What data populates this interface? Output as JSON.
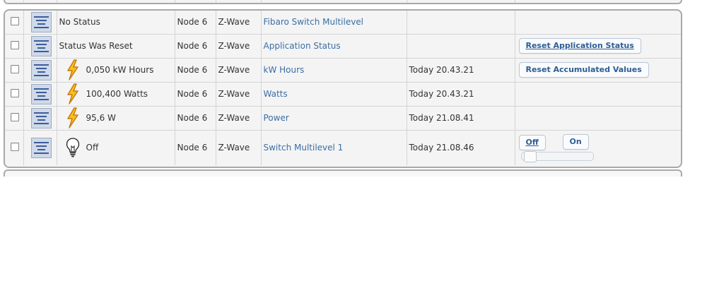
{
  "rows": [
    {
      "value": "No Status",
      "node": "Node 6",
      "type": "Z-Wave",
      "name": "Fibaro Switch Multilevel",
      "time": "",
      "icon": "none"
    },
    {
      "value": "Status Was Reset",
      "node": "Node 6",
      "type": "Z-Wave",
      "name": "Application Status",
      "time": "",
      "icon": "none",
      "action": "Reset Application Status"
    },
    {
      "value": "0,050 kW Hours",
      "node": "Node 6",
      "type": "Z-Wave",
      "name": "kW Hours",
      "time": "Today 20.43.21",
      "icon": "lightning-icon",
      "action": "Reset Accumulated Values"
    },
    {
      "value": "100,400 Watts",
      "node": "Node 6",
      "type": "Z-Wave",
      "name": "Watts",
      "time": "Today 20.43.21",
      "icon": "lightning-icon"
    },
    {
      "value": "95,6 W",
      "node": "Node 6",
      "type": "Z-Wave",
      "name": "Power",
      "time": "Today 21.08.41",
      "icon": "lightning-icon"
    },
    {
      "value": "Off",
      "node": "Node 6",
      "type": "Z-Wave",
      "name": "Switch Multilevel 1",
      "time": "Today 21.08.46",
      "icon": "light-bulb-icon",
      "controls": {
        "off_label": "Off",
        "on_label": "On",
        "slider_level": 0.05
      }
    }
  ]
}
